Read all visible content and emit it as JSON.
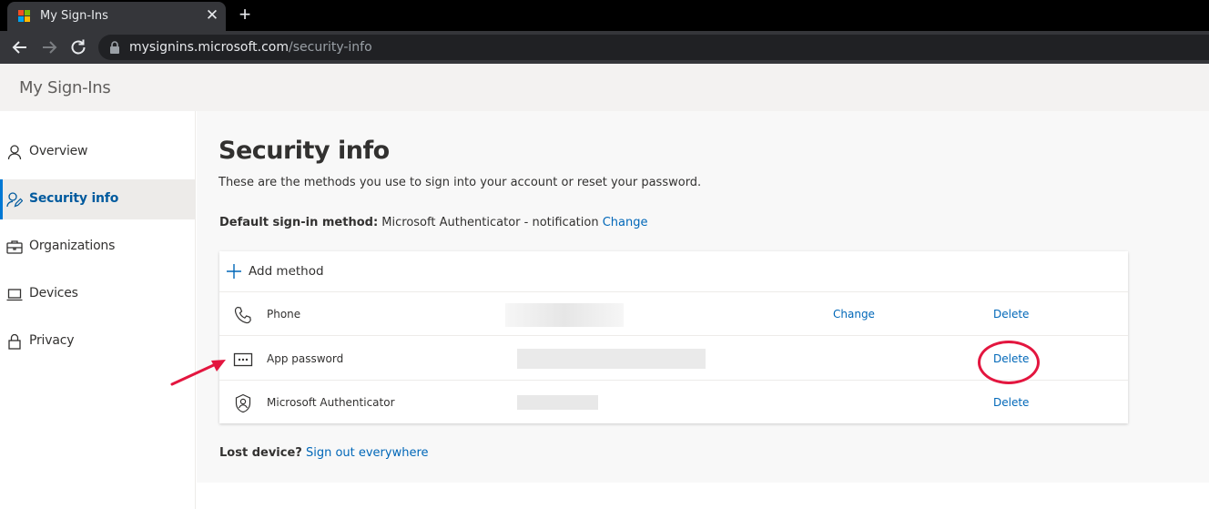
{
  "browser": {
    "tab_title": "My Sign-Ins",
    "close_symbol": "✕",
    "new_tab_symbol": "+",
    "url_host": "mysignins.microsoft.com",
    "url_path": "/security-info"
  },
  "app": {
    "title": "My Sign-Ins"
  },
  "sidebar": {
    "items": [
      {
        "label": "Overview",
        "icon": "person-icon",
        "active": false
      },
      {
        "label": "Security info",
        "icon": "person-edit-icon",
        "active": true
      },
      {
        "label": "Organizations",
        "icon": "briefcase-icon",
        "active": false
      },
      {
        "label": "Devices",
        "icon": "laptop-icon",
        "active": false
      },
      {
        "label": "Privacy",
        "icon": "lock-icon",
        "active": false
      }
    ]
  },
  "main": {
    "title": "Security info",
    "subtitle": "These are the methods you use to sign into your account or reset your password.",
    "default_method_label": "Default sign-in method:",
    "default_method_value": "Microsoft Authenticator - notification",
    "default_method_change": "Change",
    "add_method_label": "Add method",
    "methods": [
      {
        "name": "Phone",
        "icon": "phone-icon",
        "change": "Change",
        "delete": "Delete"
      },
      {
        "name": "App password",
        "icon": "app-password-icon",
        "change": "",
        "delete": "Delete"
      },
      {
        "name": "Microsoft Authenticator",
        "icon": "authenticator-icon",
        "change": "",
        "delete": "Delete"
      }
    ],
    "lost_device_label": "Lost device?",
    "lost_device_link": "Sign out everywhere"
  },
  "colors": {
    "accent": "#0067b8",
    "annotation": "#e3163f"
  }
}
